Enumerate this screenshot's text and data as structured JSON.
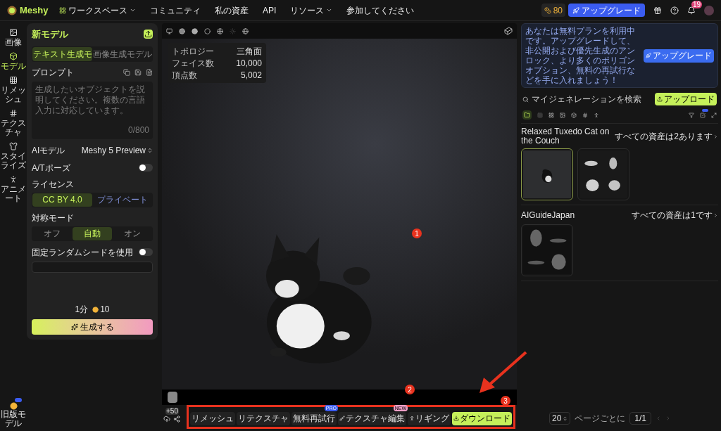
{
  "header": {
    "logo": "Meshy",
    "nav": [
      {
        "label": "ワークスペース",
        "dropdown": true
      },
      {
        "label": "コミュニティ",
        "dropdown": false
      },
      {
        "label": "私の資産",
        "dropdown": false
      },
      {
        "label": "API",
        "dropdown": false
      },
      {
        "label": "リソース",
        "dropdown": true
      },
      {
        "label": "参加してください",
        "dropdown": false
      }
    ],
    "credits": "80",
    "upgrade": "アップグレード",
    "notifications": "19"
  },
  "rail": [
    {
      "label": "画像",
      "selected": false
    },
    {
      "label": "モデル",
      "selected": true
    },
    {
      "label": "リメッシュ",
      "selected": false
    },
    {
      "label": "テクスチャ",
      "selected": false
    },
    {
      "label": "スタイライズ",
      "selected": false
    },
    {
      "label": "アニメート",
      "selected": false
    }
  ],
  "rail_bottom": {
    "label": "旧版モデル"
  },
  "panel": {
    "title": "新モデル",
    "tabs": [
      {
        "label": "テキスト生成モ",
        "selected": true
      },
      {
        "label": "画像生成モデル",
        "selected": false
      }
    ],
    "prompt_label": "プロンプト",
    "placeholder": "生成したいオブジェクトを説明してください。複数の言語入力に対応しています。",
    "counter": "0/800",
    "ai_model_label": "AIモデル",
    "ai_model": "Meshy 5 Preview",
    "pose_label": "A/Tポーズ",
    "pose_on": false,
    "license_label": "ライセンス",
    "license": [
      {
        "label": "CC BY 4.0",
        "selected": true
      },
      {
        "label": "プライベート",
        "selected": false
      }
    ],
    "symmetry_label": "対称モード",
    "symmetry": [
      {
        "label": "オフ",
        "selected": false
      },
      {
        "label": "自動",
        "selected": true
      },
      {
        "label": "オン",
        "selected": false
      }
    ],
    "seed_label": "固定ランダムシードを使用",
    "seed_on": false,
    "time": "1分",
    "cost": "10",
    "generate": "生成する"
  },
  "viewport": {
    "stats": [
      {
        "label": "トポロジー",
        "value": "三角面"
      },
      {
        "label": "フェイス数",
        "value": "10,000"
      },
      {
        "label": "頂点数",
        "value": "5,002"
      }
    ],
    "upload_count": "+50",
    "actions": [
      {
        "label": "リメッシュ",
        "kind": "plain"
      },
      {
        "label": "リテクスチャ",
        "kind": "plain"
      },
      {
        "label": "無料再試行",
        "kind": "plain",
        "badge": "PRO"
      },
      {
        "label": "テクスチャ編集",
        "kind": "texture",
        "badge": "NEW"
      },
      {
        "label": "リギング",
        "kind": "rig"
      },
      {
        "label": "ダウンロード",
        "kind": "primary"
      }
    ]
  },
  "right": {
    "notice": "あなたは無料プランを利用中です。アップグレードして、非公開および優先生成のアンロック、より多くのポリゴンオプション、無料の再試行などを手に入れましょう！",
    "notice_button": "アップグレード",
    "search_placeholder": "マイジェネレーションを検索",
    "upload": "アップロード",
    "groups": [
      {
        "title": "Relaxed Tuxedo Cat on the Couch",
        "link": "すべての資産は2あります",
        "items": [
          {
            "kind": "single",
            "selected": true
          },
          {
            "kind": "quad",
            "selected": false
          }
        ]
      },
      {
        "title": "AIGuideJapan",
        "link": "すべての資産は1です",
        "items": [
          {
            "kind": "discs",
            "selected": false
          }
        ]
      }
    ],
    "per_page": "20",
    "per_page_label": "ページごとに",
    "page": "1/1"
  },
  "annotations": [
    "1",
    "2",
    "3"
  ]
}
